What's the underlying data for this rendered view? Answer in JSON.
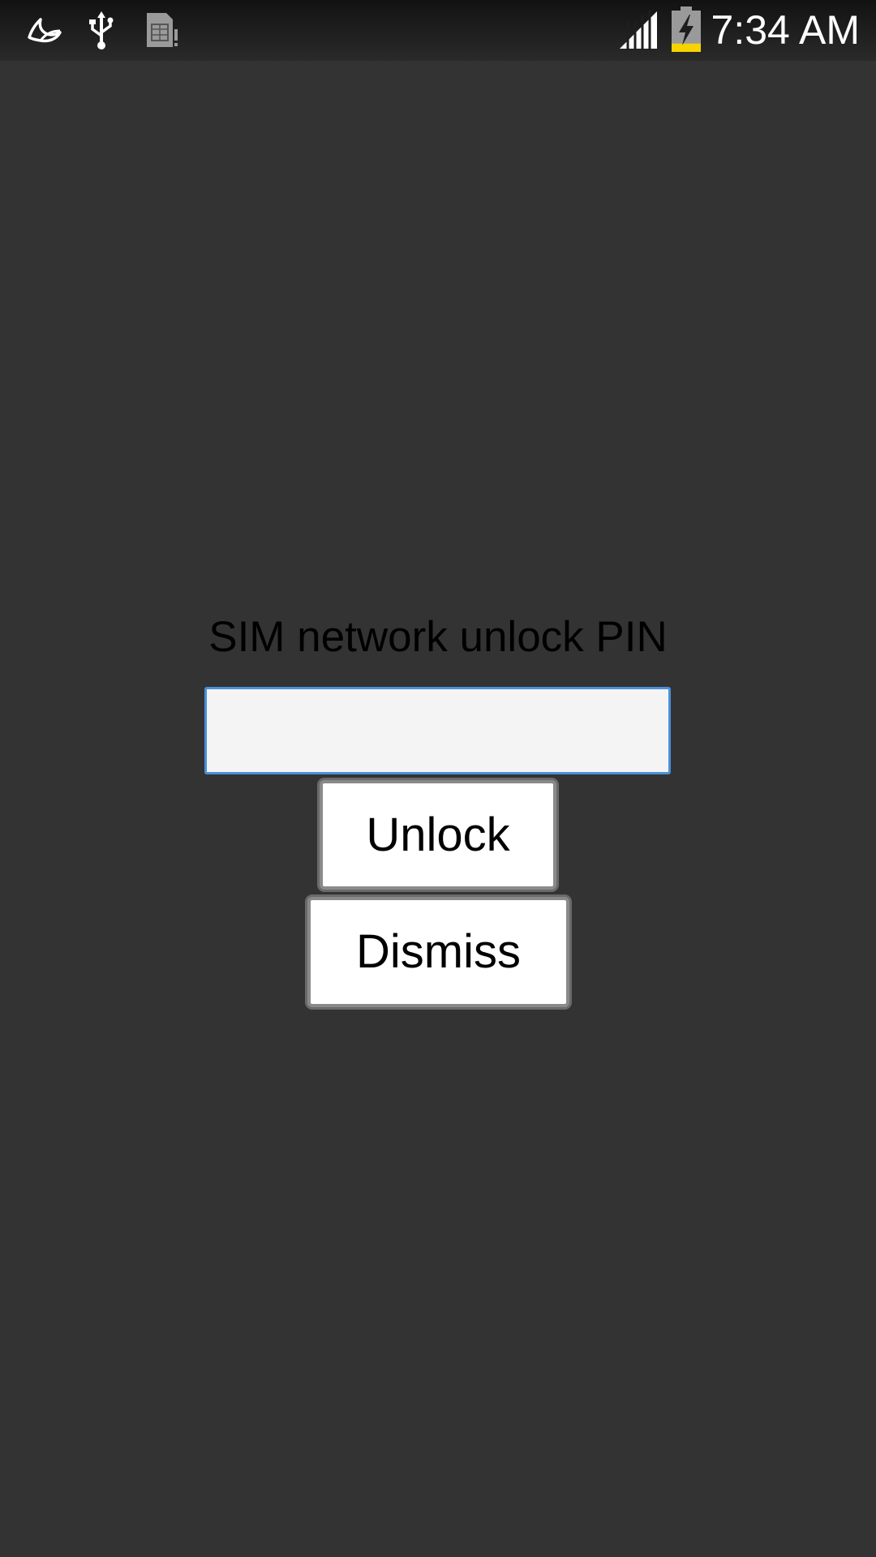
{
  "status_bar": {
    "time": "7:34 AM",
    "left_icons": [
      "swiftkey-icon",
      "usb-icon",
      "sim-card-icon"
    ],
    "right_icons": [
      "signal-icon",
      "battery-charging-icon"
    ],
    "battery_level": 0.2,
    "battery_color": "#f5d400"
  },
  "dialog": {
    "prompt": "SIM network unlock PIN",
    "pin_input": {
      "value": "",
      "placeholder": ""
    },
    "unlock_label": "Unlock",
    "dismiss_label": "Dismiss"
  },
  "colors": {
    "background": "#333333",
    "input_focus_border": "#4a90d9"
  }
}
